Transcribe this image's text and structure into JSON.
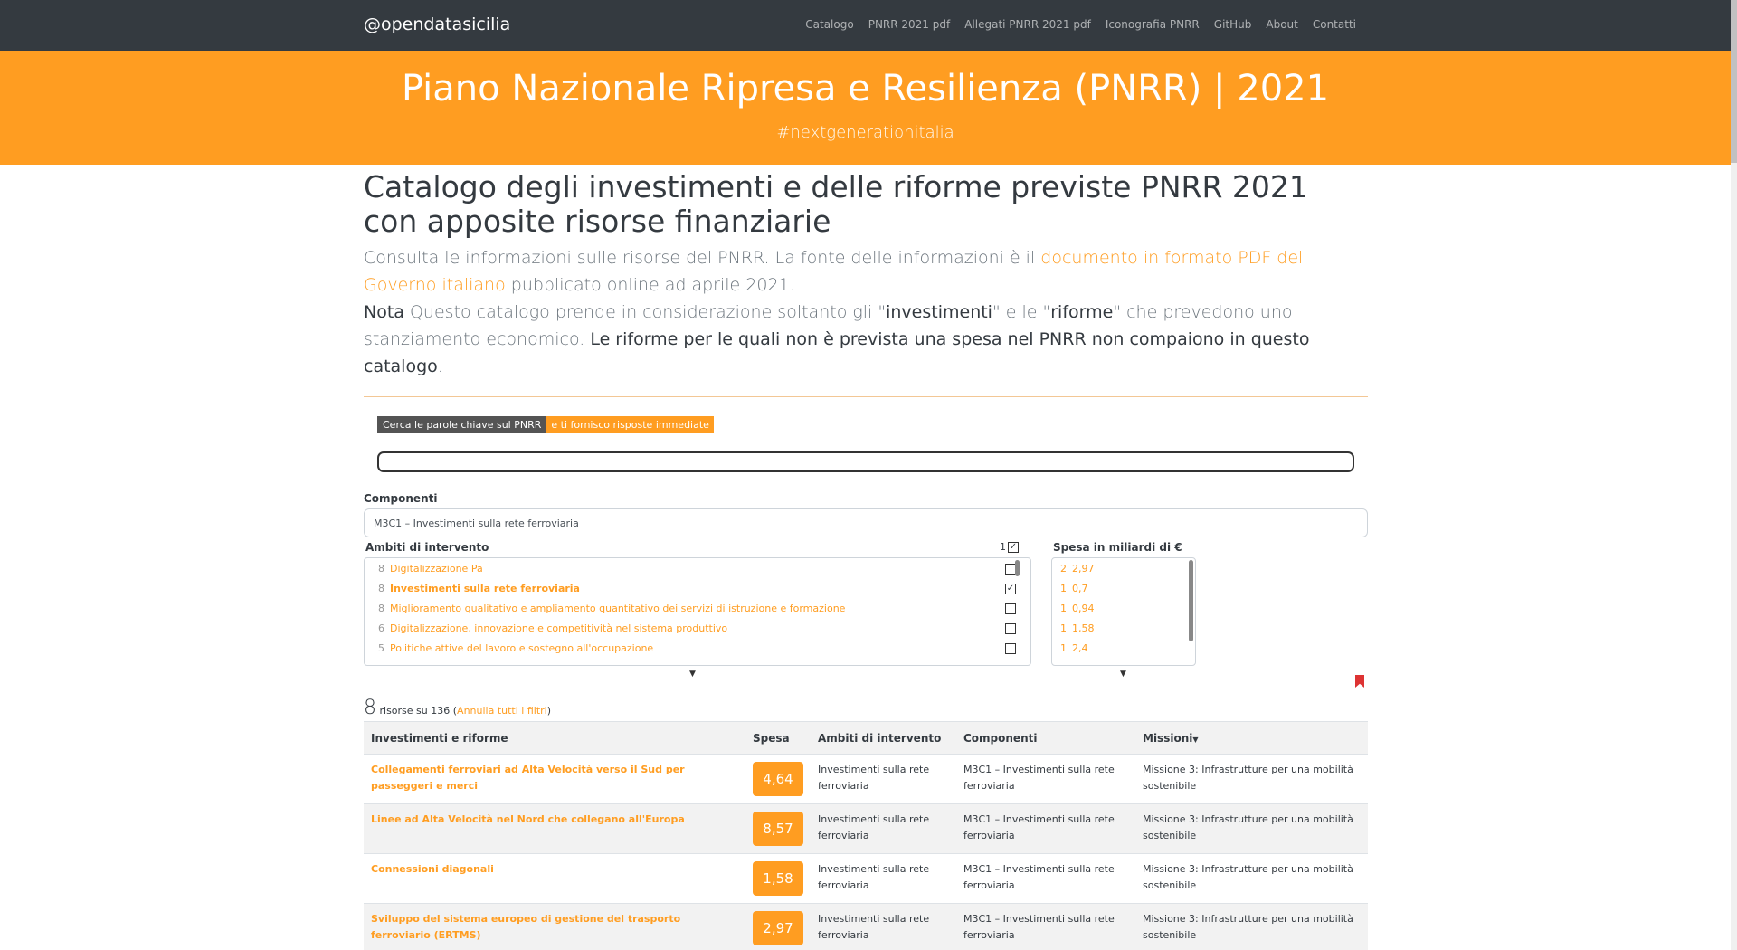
{
  "nav": {
    "brand": "@opendatasicilia",
    "links": [
      "Catalogo",
      "PNRR 2021 pdf",
      "Allegati PNRR 2021 pdf",
      "Iconografia PNRR",
      "GitHub",
      "About",
      "Contatti"
    ]
  },
  "hero": {
    "title": "Piano Nazionale Ripresa e Resilienza (PNRR) | 2021",
    "subtitle": "#nextgenerationitalia"
  },
  "intro": {
    "title": "Catalogo degli investimenti e delle riforme previste PNRR 2021 con apposite risorse finanziarie",
    "p1_a": "Consulta le informazioni sulle risorse del PNRR. La fonte delle informazioni è il ",
    "p1_link": "documento in formato PDF del Governo italiano",
    "p1_b": " pubblicato online ad aprile 2021.",
    "nota": "Nota",
    "p2_a": " Questo catalogo prende in considerazione soltanto gli \"",
    "p2_inv": "investimenti",
    "p2_b": "\" e le \"",
    "p2_rif": "riforme",
    "p2_c": "\" che prevedono uno stanziamento economico. ",
    "p2_bold": "Le riforme per le quali non è prevista una spesa nel PNRR non compaiono in questo catalogo",
    "p2_end": "."
  },
  "search": {
    "badge_dark": "Cerca le parole chiave sul PNRR",
    "badge_orange": "e ti fornisco risposte immediate",
    "value": ""
  },
  "filters": {
    "componenti_label": "Componenti",
    "componenti_value": "M3C1 – Investimenti sulla rete ferroviaria",
    "ambiti_label": "Ambiti di intervento",
    "ambiti_selected_count": "1",
    "ambiti": [
      {
        "count": "8",
        "label": "Digitalizzazione Pa",
        "checked": false
      },
      {
        "count": "8",
        "label": "Investimenti sulla rete ferroviaria",
        "checked": true
      },
      {
        "count": "8",
        "label": "Miglioramento qualitativo e ampliamento quantitativo dei servizi di istruzione e formazione",
        "checked": false
      },
      {
        "count": "6",
        "label": "Digitalizzazione, innovazione e competitività nel sistema produttivo",
        "checked": false
      },
      {
        "count": "5",
        "label": "Politiche attive del lavoro e sostegno all'occupazione",
        "checked": false
      }
    ],
    "spesa_label": "Spesa in miliardi di €",
    "spesa": [
      {
        "count": "2",
        "value": "2,97"
      },
      {
        "count": "1",
        "value": "0,7"
      },
      {
        "count": "1",
        "value": "0,94"
      },
      {
        "count": "1",
        "value": "1,58"
      },
      {
        "count": "1",
        "value": "2,4"
      }
    ]
  },
  "results": {
    "shown": "8",
    "text": " risorse su 136 (",
    "reset": "Annulla tutti i filtri",
    "close": ")"
  },
  "table": {
    "headers": [
      "Investimenti e riforme",
      "Spesa",
      "Ambiti di intervento",
      "Componenti",
      "Missioni"
    ],
    "rows": [
      {
        "inv": "Collegamenti ferroviari ad Alta Velocità verso il Sud per passeggeri e merci",
        "spesa": "4,64",
        "ambito": "Investimenti sulla rete ferroviaria",
        "comp": "M3C1 – Investimenti sulla rete ferroviaria",
        "miss": "Missione 3: Infrastrutture per una mobilità sostenibile"
      },
      {
        "inv": "Linee ad Alta Velocità nel Nord che collegano all'Europa",
        "spesa": "8,57",
        "ambito": "Investimenti sulla rete ferroviaria",
        "comp": "M3C1 – Investimenti sulla rete ferroviaria",
        "miss": "Missione 3: Infrastrutture per una mobilità sostenibile"
      },
      {
        "inv": "Connessioni diagonali",
        "spesa": "1,58",
        "ambito": "Investimenti sulla rete ferroviaria",
        "comp": "M3C1 – Investimenti sulla rete ferroviaria",
        "miss": "Missione 3: Infrastrutture per una mobilità sostenibile"
      },
      {
        "inv": "Sviluppo del sistema europeo di gestione del trasporto ferroviario (ERTMS)",
        "spesa": "2,97",
        "ambito": "Investimenti sulla rete ferroviaria",
        "comp": "M3C1 – Investimenti sulla rete ferroviaria",
        "miss": "Missione 3: Infrastrutture per una mobilità sostenibile"
      }
    ]
  }
}
